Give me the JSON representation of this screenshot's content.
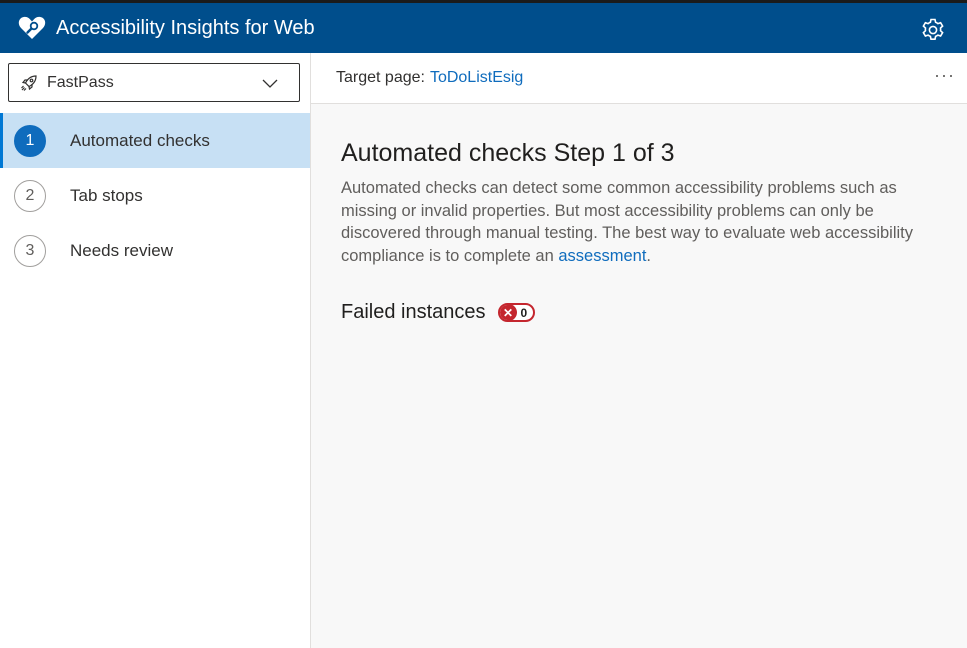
{
  "header": {
    "app_title": "Accessibility Insights for Web",
    "logo_icon": "heart-magnifier-icon",
    "settings_icon": "gear-icon",
    "background_color": "#004e8c"
  },
  "sidebar": {
    "dropdown": {
      "icon": "rocket-icon",
      "selected_value": "FastPass",
      "chevron_icon": "chevron-down-icon"
    },
    "steps": [
      {
        "number": "1",
        "label": "Automated checks",
        "selected": true
      },
      {
        "number": "2",
        "label": "Tab stops",
        "selected": false
      },
      {
        "number": "3",
        "label": "Needs review",
        "selected": false
      }
    ]
  },
  "target": {
    "label": "Target page:",
    "link_text": "ToDoListEsig",
    "more_icon": "ellipsis-icon"
  },
  "content": {
    "heading": "Automated checks Step 1 of 3",
    "description_text": "Automated checks can detect some common accessibility problems such as missing or invalid properties. But most accessibility problems can only be discovered through manual testing. The best way to evaluate web accessibility compliance is to complete an",
    "description_link": "assessment",
    "description_end": ".",
    "failed_label": "Failed instances",
    "failed_count": "0",
    "failed_icon": "error-x-icon"
  }
}
